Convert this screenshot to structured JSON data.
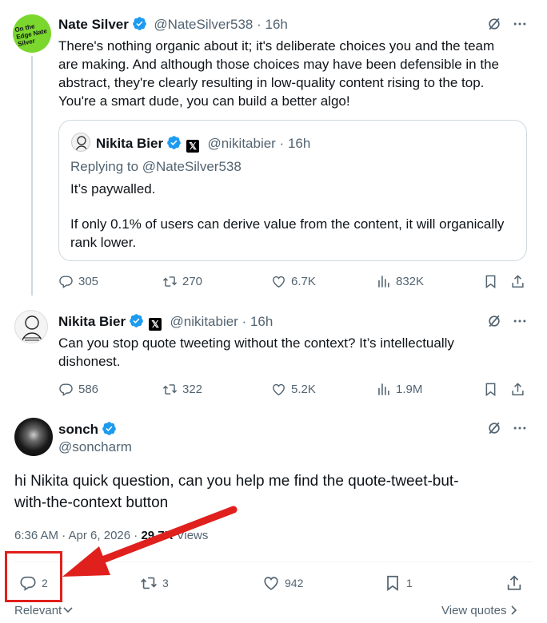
{
  "tweet1": {
    "name": "Nate Silver",
    "handle": "@NateSilver538 · 16h",
    "avatar_text": "On the Edge Nate Silver",
    "lines": [
      "There's nothing organic about it; it's deliberate choices you and the team",
      "are making. And although those choices may have been defensible in the",
      "abstract, they're clearly resulting in low-quality content rising to the top.",
      "You're a smart dude, you can build a better algo!"
    ],
    "quote": {
      "name": "Nikita Bier",
      "handle": "@nikitabier · 16h",
      "replying": "Replying to @NateSilver538",
      "line1": "It’s paywalled.",
      "line2": "If only 0.1% of users can derive value from the content, it will organically",
      "line3": "rank lower."
    },
    "stats": {
      "replies": "305",
      "retweets": "270",
      "likes": "6.7K",
      "views": "832K"
    }
  },
  "tweet2": {
    "name": "Nikita Bier",
    "handle": "@nikitabier · 16h",
    "lines": [
      "Can you stop quote tweeting without the context? It’s intellectually",
      "dishonest."
    ],
    "stats": {
      "replies": "586",
      "retweets": "322",
      "likes": "5.2K",
      "views": "1.9M"
    }
  },
  "main": {
    "name": "sonch",
    "handle": "@soncharm",
    "lines": [
      "hi Nikita quick question, can you help me find the quote-tweet-but-",
      "with-the-context button"
    ],
    "timestamp": "6:36 AM · Apr 6, 2026 · ",
    "views_count": "29.7K",
    "views_label": " Views",
    "stats": {
      "replies": "2",
      "retweets": "3",
      "likes": "942",
      "bookmarks": "1"
    }
  },
  "footer": {
    "relevant": "Relevant",
    "view_quotes": "View quotes"
  },
  "colors": {
    "verified": "#1d9bf0",
    "annotation": "#e0201c",
    "avatar_bg": "#7bd62e"
  },
  "icons": [
    "verified-icon",
    "x-logo-icon",
    "grok-icon",
    "more-icon",
    "reply-icon",
    "retweet-icon",
    "like-icon",
    "views-icon",
    "bookmark-icon",
    "share-icon",
    "chevron-down-icon",
    "chevron-right-icon",
    "arrow-annotation"
  ]
}
